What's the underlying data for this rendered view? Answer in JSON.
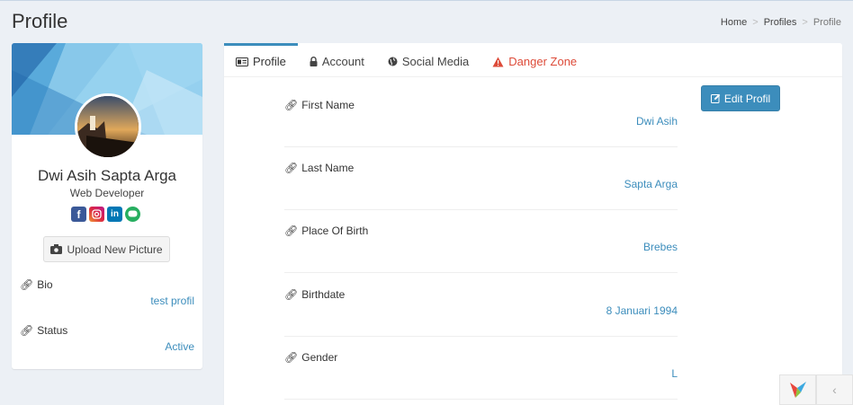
{
  "header": {
    "title": "Profile",
    "breadcrumb": [
      "Home",
      "Profiles",
      "Profile"
    ]
  },
  "profile_card": {
    "name": "Dwi Asih Sapta Arga",
    "job": "Web Developer",
    "social_icons": [
      "facebook-icon",
      "instagram-icon",
      "linkedin-icon",
      "line-icon"
    ],
    "upload_label": "Upload New Picture",
    "bio_label": "Bio",
    "bio_value": "test profil",
    "status_label": "Status",
    "status_value": "Active"
  },
  "tabs": [
    {
      "label": "Profile",
      "icon": "id-card-icon",
      "active": true
    },
    {
      "label": "Account",
      "icon": "lock-icon"
    },
    {
      "label": "Social Media",
      "icon": "globe-icon"
    },
    {
      "label": "Danger Zone",
      "icon": "warning-icon"
    }
  ],
  "edit_label": "Edit Profil",
  "fields": [
    {
      "label": "First Name",
      "value": "Dwi Asih"
    },
    {
      "label": "Last Name",
      "value": "Sapta Arga"
    },
    {
      "label": "Place Of Birth",
      "value": "Brebes"
    },
    {
      "label": "Birthdate",
      "value": "8 Januari 1994"
    },
    {
      "label": "Gender",
      "value": "L"
    }
  ],
  "colors": {
    "accent": "#3c8dbc",
    "danger": "#dd4b39",
    "background": "#ecf0f5"
  }
}
